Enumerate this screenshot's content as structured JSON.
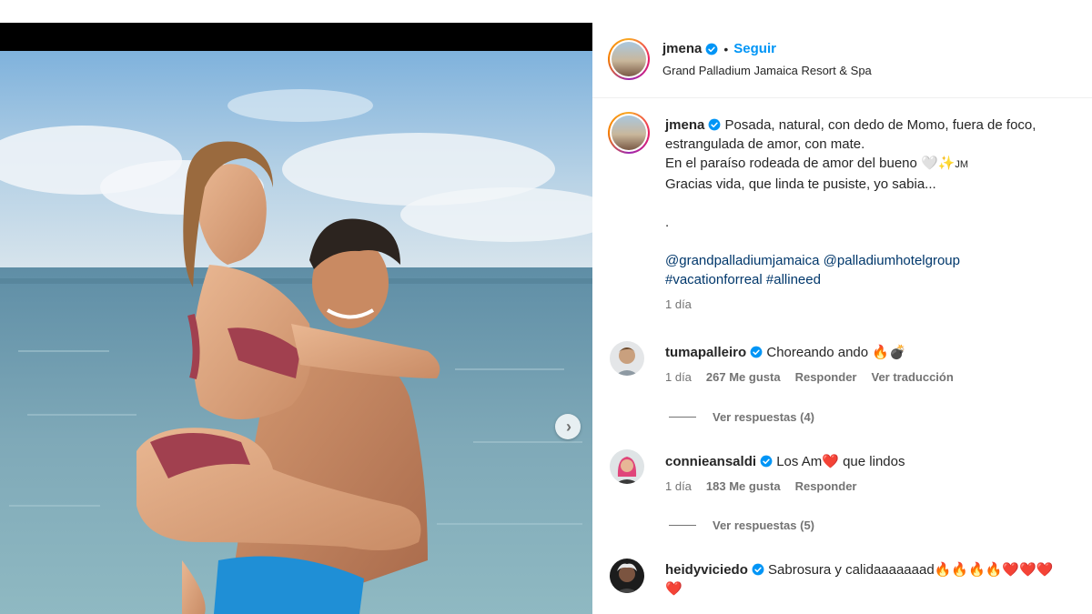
{
  "post": {
    "author": "jmena",
    "follow_label": "Seguir",
    "location": "Grand Palladium Jamaica Resort & Spa",
    "caption": {
      "line1": "Posada, natural, con dedo de Momo, fuera de foco,",
      "line2": "estrangulada de amor, con mate.",
      "line3": "En el paraíso rodeada de amor del bueno",
      "line3_emoji": "🤍✨",
      "line3_tail": "JM",
      "line4": "Gracias vida, que linda te pusiste, yo sabia...",
      "line5": ".",
      "mention1": "@grandpalladiumjamaica",
      "mention2": "@palladiumhotelgroup",
      "hashtag1": "#vacationforreal",
      "hashtag2": "#allineed",
      "time": "1 día"
    }
  },
  "comments": [
    {
      "user": "tumapalleiro",
      "text": "Choreando ando",
      "emoji": "🔥💣",
      "time": "1 día",
      "likes": "267 Me gusta",
      "reply": "Responder",
      "translate": "Ver traducción",
      "view_replies": "Ver respuestas (4)"
    },
    {
      "user": "connieansaldi",
      "text_before": "Los Am",
      "text_after": "que lindos",
      "emoji": "❤️",
      "time": "1 día",
      "likes": "183 Me gusta",
      "reply": "Responder",
      "view_replies": "Ver respuestas (5)"
    },
    {
      "user": "heidyviciedo",
      "text": "Sabrosura y calidaaaaaaad",
      "emoji": "🔥🔥🔥🔥❤️❤️❤️",
      "emoji_wrap": "❤️"
    }
  ],
  "icons": {
    "verified": "verified-badge-icon",
    "next": "chevron-right-icon"
  },
  "colors": {
    "link": "#00376b",
    "follow": "#0095f6",
    "verified": "#0095f6",
    "muted": "#737373"
  }
}
